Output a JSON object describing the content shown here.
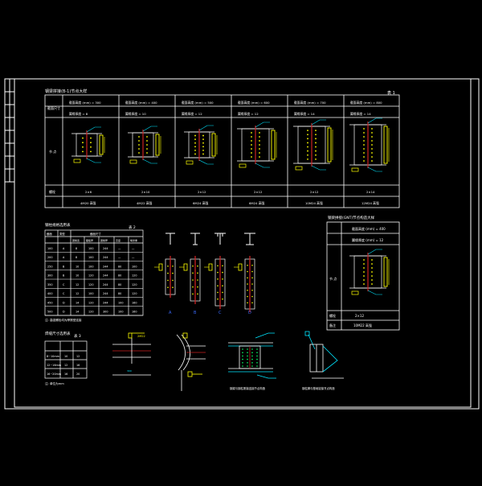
{
  "colors": {
    "background": "#000000",
    "frame": "#ffffff",
    "line": "#ffffff",
    "column": "#cc2222",
    "bolt": "#ffff00",
    "dim": "#00e5ff",
    "weld": "#00ff66",
    "text": "#ffffff"
  },
  "table1": {
    "title": "钢梁拼接(B-1)节点大样",
    "index": "表 1",
    "row_head_1": "截面尺寸",
    "row_head_2": "节 点",
    "row_head_3": "螺栓",
    "columns": [
      {
        "h1": "截面高度 (mm) = 300",
        "h2": "翼缘厚度 = 8",
        "bolts": "2×6",
        "note": "4M20 高强"
      },
      {
        "h1": "截面高度 (mm) = 400",
        "h2": "翼缘厚度 = 10",
        "bolts": "2×10",
        "note": "4M22 高强"
      },
      {
        "h1": "截面高度 (mm) = 500",
        "h2": "翼缘厚度 = 12",
        "bolts": "2×12",
        "note": "6M24 高强"
      },
      {
        "h1": "截面高度 (mm) = 600",
        "h2": "翼缘厚度 = 12",
        "bolts": "2×12",
        "note": "6M24 高强"
      },
      {
        "h1": "截面高度 (mm) = 700",
        "h2": "翼缘厚度 = 14",
        "bolts": "2×12",
        "note": "10M24 高强"
      },
      {
        "h1": "截面高度 (mm) = 800",
        "h2": "翼缘厚度 = 14",
        "bolts": "2×14",
        "note": "12M24 高强"
      }
    ]
  },
  "table2": {
    "title": "钢柱规格选用表",
    "index": "表 2",
    "headers": [
      "截面",
      "类型",
      "截面尺寸"
    ],
    "subheaders": [
      "翼缘宽",
      "腹板厚",
      "翼缘厚",
      "高度",
      "每米重",
      "回转半径"
    ],
    "rows": [
      [
        "100",
        "A",
        "8",
        "100",
        "244",
        "—",
        "—"
      ],
      [
        "200",
        "A",
        "8",
        "100",
        "244",
        "—",
        "—"
      ],
      [
        "250",
        "B",
        "10",
        "100",
        "244",
        "80",
        "100"
      ],
      [
        "300",
        "B",
        "10",
        "120",
        "244",
        "80",
        "120"
      ],
      [
        "350",
        "C",
        "12",
        "120",
        "244",
        "80",
        "120"
      ],
      [
        "400",
        "C",
        "12",
        "100",
        "244",
        "80",
        "120"
      ],
      [
        "450",
        "D",
        "14",
        "120",
        "244",
        "100",
        "160"
      ],
      [
        "500",
        "D",
        "14",
        "120",
        "300",
        "100",
        "160"
      ]
    ],
    "note": "注: 高强螺栓均为摩擦型连接"
  },
  "table3": {
    "title": "焊缝尺寸选用表",
    "index": "表 3",
    "rows": [
      [
        "8~10mm",
        "10",
        "12"
      ],
      [
        "12~16mm",
        "12",
        "16"
      ],
      [
        "16~20mm",
        "16",
        "20"
      ]
    ],
    "note": "注: 单位为mm"
  },
  "types": [
    "A",
    "B",
    "C",
    "D"
  ],
  "table4": {
    "title": "钢梁拼接(GNT)节点构造大样",
    "row1": "截面高度 (mm) = 400",
    "row2": "翼缘厚度 (mm) = 12",
    "row_head": "节 点",
    "bolt_label": "螺栓",
    "bolt_value": "2×12",
    "note_label": "备注",
    "note_value": "10M22 高强"
  },
  "captions": {
    "detail3": "钢梁与钢柱刚接连接节点构造",
    "detail4": "钢柱脚与基础铰接节点构造"
  }
}
